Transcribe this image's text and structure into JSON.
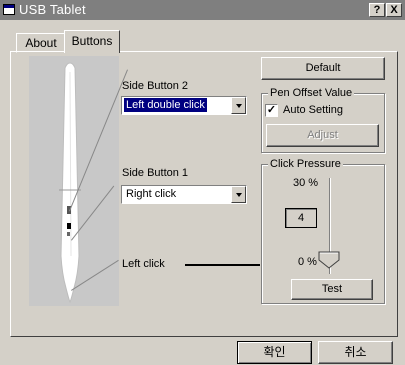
{
  "window": {
    "title": "USB Tablet",
    "help_label": "?",
    "close_label": "X"
  },
  "tabs": [
    {
      "label": "About"
    },
    {
      "label": "Buttons"
    }
  ],
  "side_button_2": {
    "label": "Side Button 2",
    "value": "Left double click"
  },
  "side_button_1": {
    "label": "Side Button 1",
    "value": "Right click"
  },
  "left_click": {
    "label": "Left click"
  },
  "default_button": {
    "label": "Default"
  },
  "pen_offset": {
    "legend": "Pen Offset Value",
    "auto_label": "Auto Setting",
    "auto_checked": true,
    "adjust_label": "Adjust"
  },
  "click_pressure": {
    "legend": "Click Pressure",
    "max_label": "30 %",
    "min_label": "0 %",
    "value": "4",
    "test_label": "Test"
  },
  "footer": {
    "ok_label": "확인",
    "cancel_label": "취소"
  }
}
